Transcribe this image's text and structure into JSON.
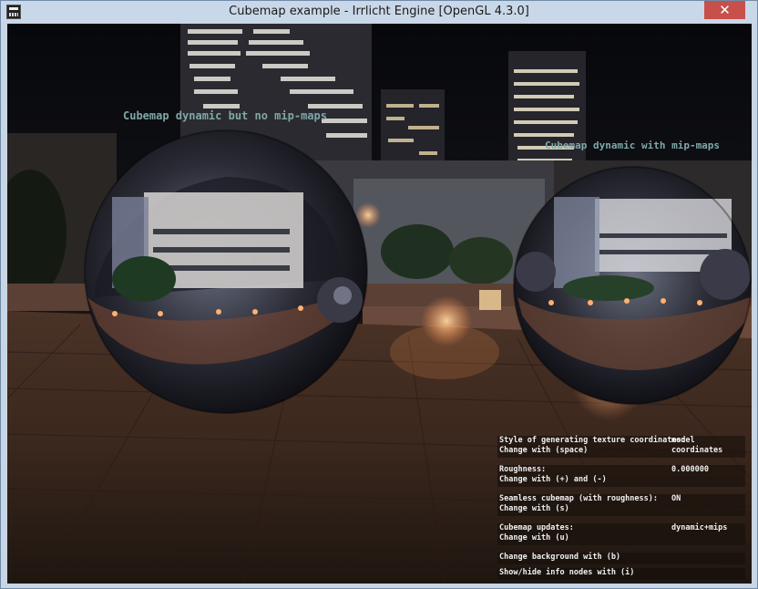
{
  "window": {
    "title": "Cubemap example - Irrlicht Engine [OpenGL 4.3.0]",
    "close_label": "✕"
  },
  "scene": {
    "sphere_left_label": "Cubemap dynamic but no mip-maps",
    "sphere_right_label": "Cubemap dynamic with mip-maps",
    "label_color": "#7fa8a8"
  },
  "info": {
    "rows": [
      {
        "key": "Style of generating texture coordinates:",
        "hint": "Change with (space)",
        "value": "model coordinates"
      },
      {
        "key": "Roughness:",
        "hint": "Change with (+) and (-)",
        "value": "0.000000"
      },
      {
        "key": "Seamless cubemap (with roughness):",
        "hint": "Change with (s)",
        "value": "ON"
      },
      {
        "key": "Cubemap updates:",
        "hint": "Change with (u)",
        "value": "dynamic+mips"
      },
      {
        "key": "Change background with (b)",
        "hint": "",
        "value": ""
      },
      {
        "key": "Show/hide info nodes with (i)",
        "hint": "",
        "value": ""
      }
    ]
  },
  "colors": {
    "titlebar": "#c9d8e8",
    "close": "#c7504a"
  }
}
